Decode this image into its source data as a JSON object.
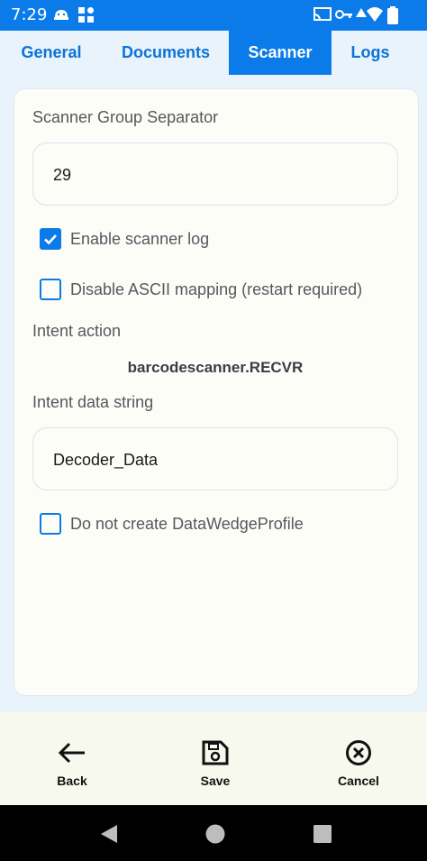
{
  "status_bar": {
    "time": "7:29",
    "icons": [
      "android-robot-icon",
      "grid-app-icon",
      "cast-icon",
      "vpn-key-icon",
      "signal-icon",
      "wifi-icon",
      "battery-icon"
    ]
  },
  "tabs": [
    {
      "label": "General",
      "active": false
    },
    {
      "label": "Documents",
      "active": false
    },
    {
      "label": "Scanner",
      "active": true
    },
    {
      "label": "Logs",
      "active": false
    }
  ],
  "scanner": {
    "group_separator_label": "Scanner Group Separator",
    "group_separator_value": "29",
    "enable_log_label": "Enable scanner log",
    "enable_log_checked": true,
    "disable_ascii_label": "Disable ASCII mapping (restart required)",
    "disable_ascii_checked": false,
    "intent_action_label": "Intent action",
    "intent_action_value": "barcodescanner.RECVR",
    "intent_data_label": "Intent data string",
    "intent_data_value": "Decoder_Data",
    "no_profile_label": "Do not create DataWedgeProfile",
    "no_profile_checked": false
  },
  "actions": {
    "back_label": "Back",
    "save_label": "Save",
    "cancel_label": "Cancel"
  },
  "colors": {
    "accent": "#0a7be9",
    "background": "#e9f3fb",
    "card": "#fbfdf6"
  }
}
